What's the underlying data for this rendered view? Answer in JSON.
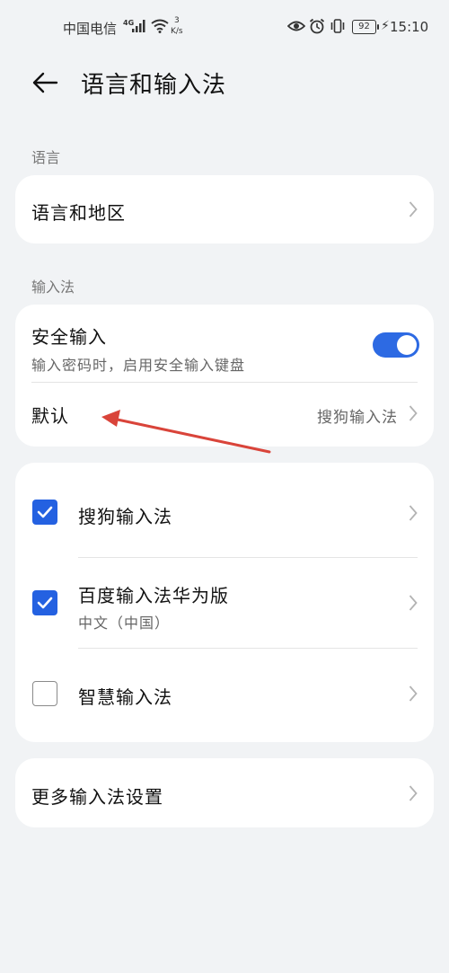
{
  "status_bar": {
    "carrier": "中国电信",
    "network": "4G",
    "speed_value": "3",
    "speed_unit": "K/s",
    "battery": "92",
    "time": "15:10"
  },
  "header": {
    "title": "语言和输入法"
  },
  "sections": {
    "language_label": "语言",
    "input_label": "输入法"
  },
  "language_card": {
    "item_label": "语言和地区"
  },
  "input_card": {
    "secure_title": "安全输入",
    "secure_subtitle": "输入密码时，启用安全输入键盘",
    "secure_enabled": true,
    "default_label": "默认",
    "default_value": "搜狗输入法"
  },
  "ime_list": [
    {
      "label": "搜狗输入法",
      "subtitle": "",
      "checked": true
    },
    {
      "label": "百度输入法华为版",
      "subtitle": "中文（中国）",
      "checked": true
    },
    {
      "label": "智慧输入法",
      "subtitle": "",
      "checked": false
    }
  ],
  "more_card": {
    "label": "更多输入法设置"
  },
  "colors": {
    "accent": "#2d6ae3",
    "background": "#f1f3f5",
    "annotation_arrow": "#d9443a"
  }
}
